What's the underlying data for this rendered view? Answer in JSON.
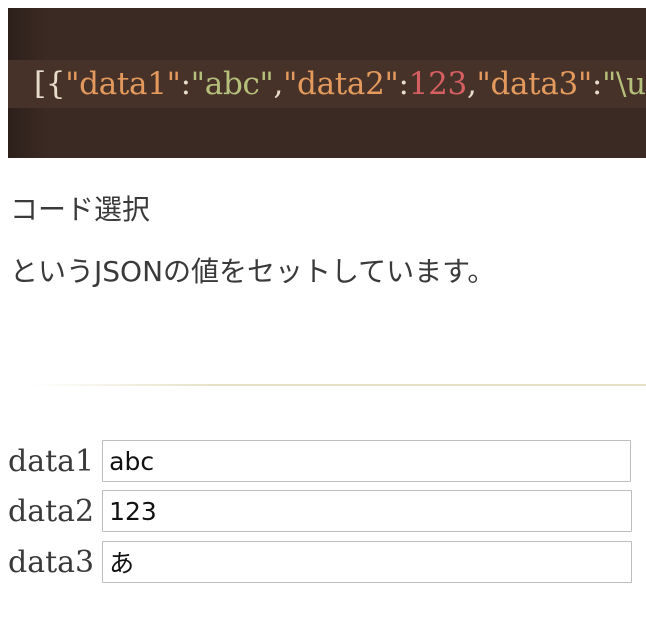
{
  "code_block": {
    "tokens": [
      {
        "type": "punct",
        "text": "[{"
      },
      {
        "type": "key",
        "text": "\"data1\""
      },
      {
        "type": "punct",
        "text": ":"
      },
      {
        "type": "str",
        "text": "\"abc\""
      },
      {
        "type": "punct",
        "text": ","
      },
      {
        "type": "key",
        "text": "\"data2\""
      },
      {
        "type": "punct",
        "text": ":"
      },
      {
        "type": "num",
        "text": "123"
      },
      {
        "type": "punct",
        "text": ","
      },
      {
        "type": "key",
        "text": "\"data3\""
      },
      {
        "type": "punct",
        "text": ":"
      },
      {
        "type": "str",
        "text": "\"\\u"
      }
    ],
    "colors": {
      "background": "#3b2a23",
      "punct": "#e8dccb",
      "key": "#e39a5c",
      "str": "#b5c07a",
      "num": "#d65f61"
    }
  },
  "paragraph": {
    "line1": "コード選択",
    "line2": "というJSONの値をセットしています。"
  },
  "form": {
    "data1": {
      "label": "data1",
      "value": "abc"
    },
    "data2": {
      "label": "data2",
      "value": "123"
    },
    "data3": {
      "label": "data3",
      "value": "あ"
    }
  }
}
